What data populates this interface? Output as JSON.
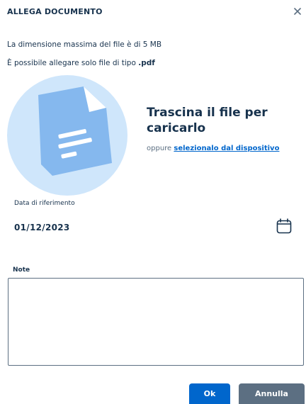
{
  "dialog": {
    "title": "ALLEGA DOCUMENTO",
    "close_icon": "close-icon"
  },
  "info": {
    "max_size": "La dimensione massima del file è di 5 MB",
    "file_type_prefix": "È possibile allegare solo file di tipo ",
    "file_type_ext": ".pdf"
  },
  "upload": {
    "icon": "document-icon",
    "title": "Trascina il file per caricarlo",
    "alt_prefix": "oppure ",
    "alt_link": "selezionalo dal dispositivo"
  },
  "date": {
    "label": "Data di riferimento",
    "value": "01/12/2023",
    "icon": "calendar-icon"
  },
  "note": {
    "label": "Note",
    "value": ""
  },
  "actions": {
    "ok_label": "Ok",
    "cancel_label": "Annulla"
  },
  "colors": {
    "primary": "#0066cc",
    "secondary": "#5c6f82",
    "text": "#17324d",
    "illustration_bg": "#cfe6fb",
    "illustration_doc": "#85b8ee"
  }
}
